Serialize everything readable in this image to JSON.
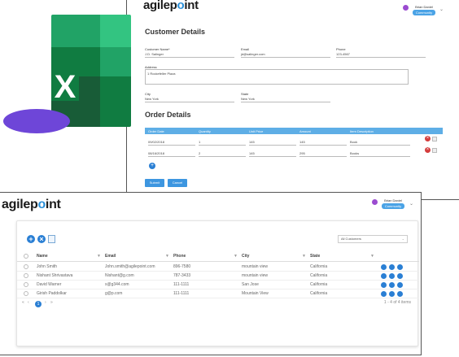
{
  "brand_prefix": "agilep",
  "brand_o": "o",
  "brand_suffix": "int",
  "user": {
    "name": "Brian Daniel",
    "role": "Community"
  },
  "form": {
    "section_customer": "Customer Details",
    "fields": {
      "customer_name_label": "Customer Name*",
      "customer_name_value": "J.D. Salinger",
      "email_label": "Email",
      "email_value": "jd@salinger.com",
      "phone_label": "Phone",
      "phone_value": "123-4567",
      "address_label": "Address",
      "address_value": "1 Rockefeller Plaza",
      "city_label": "City",
      "city_value": "New York",
      "state_label": "State",
      "state_value": "New York"
    },
    "section_order": "Order Details",
    "order_columns": [
      "Order Date",
      "Quantity",
      "Unit Price",
      "Amount",
      "Item Description"
    ],
    "order_rows": [
      [
        "09/02/2018",
        "1",
        "145",
        "145",
        "Book"
      ],
      [
        "08/16/2018",
        "2",
        "145",
        "295",
        "Books"
      ]
    ],
    "submit_label": "Submit",
    "cancel_label": "Cancel"
  },
  "excel_letter": "X",
  "list": {
    "filter_value": "All Customers",
    "columns": [
      "Name",
      "Email",
      "Phone",
      "City",
      "State"
    ],
    "rows": [
      [
        "John Smith",
        "John.smith@agilepoint.com",
        "896-7580",
        "mountain view",
        "California"
      ],
      [
        "Nishant Shrivastava",
        "Nishant@g.com",
        "787-3433",
        "mountain view",
        "California"
      ],
      [
        "David Warner",
        "s@g344.com",
        "111-1111",
        "San Jose",
        "California"
      ],
      [
        "Girish Paddolkar",
        "g@p.com",
        "111-1111",
        "Mountain View",
        "California"
      ]
    ],
    "pager_page": "1",
    "pager_summary": "1 - 4 of 4 items"
  },
  "colors": {
    "accent": "#2a7fd4",
    "table_header": "#5eaee6",
    "excel_dark": "#185c37",
    "excel_mid": "#21a366",
    "excel_light": "#33c481",
    "oval": "#6e46d8",
    "delete": "#d43c3c"
  },
  "icons": [
    "add-icon",
    "delete-icon",
    "save-icon",
    "filter-icon",
    "edit-icon",
    "info-icon",
    "copy-icon"
  ]
}
